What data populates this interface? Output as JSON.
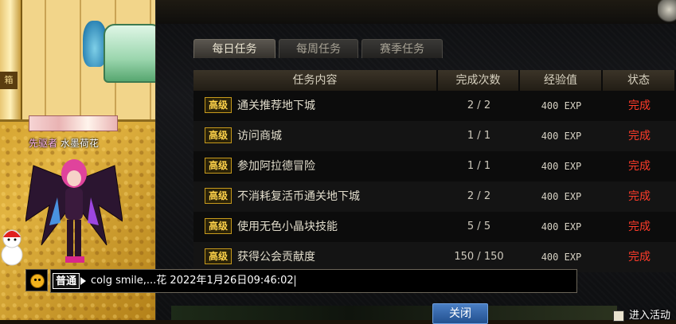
{
  "world": {
    "player_title": "先驱者",
    "player_name": "水墨荷花",
    "sign_text": "箱"
  },
  "panel": {
    "tabs": [
      {
        "label": "每日任务",
        "active": true
      },
      {
        "label": "每周任务",
        "active": false
      },
      {
        "label": "赛季任务",
        "active": false
      }
    ],
    "columns": [
      "任务内容",
      "完成次数",
      "经验值",
      "状态"
    ],
    "rows": [
      {
        "tag": "高级",
        "name": "通关推荐地下城",
        "count": "2 / 2",
        "exp": "400 EXP",
        "status": "完成"
      },
      {
        "tag": "高级",
        "name": "访问商城",
        "count": "1 / 1",
        "exp": "400 EXP",
        "status": "完成"
      },
      {
        "tag": "高级",
        "name": "参加阿拉德冒险",
        "count": "1 / 1",
        "exp": "400 EXP",
        "status": "完成"
      },
      {
        "tag": "高级",
        "name": "不消耗复活币通关地下城",
        "count": "2 / 2",
        "exp": "400 EXP",
        "status": "完成"
      },
      {
        "tag": "高级",
        "name": "使用无色小晶块技能",
        "count": "5 / 5",
        "exp": "400 EXP",
        "status": "完成"
      },
      {
        "tag": "高级",
        "name": "获得公会贡献度",
        "count": "150 / 150",
        "exp": "400 EXP",
        "status": "完成"
      }
    ],
    "close_label": "关闭"
  },
  "event": {
    "label": "进入活动"
  },
  "chat": {
    "channel": "普通",
    "text": "colg smile,...花 2022年1月26日09:46:02"
  },
  "colors": {
    "status_done": "#ff3b2a",
    "tag_gold": "#ffd34a",
    "player_title": "#ffb6f0"
  }
}
